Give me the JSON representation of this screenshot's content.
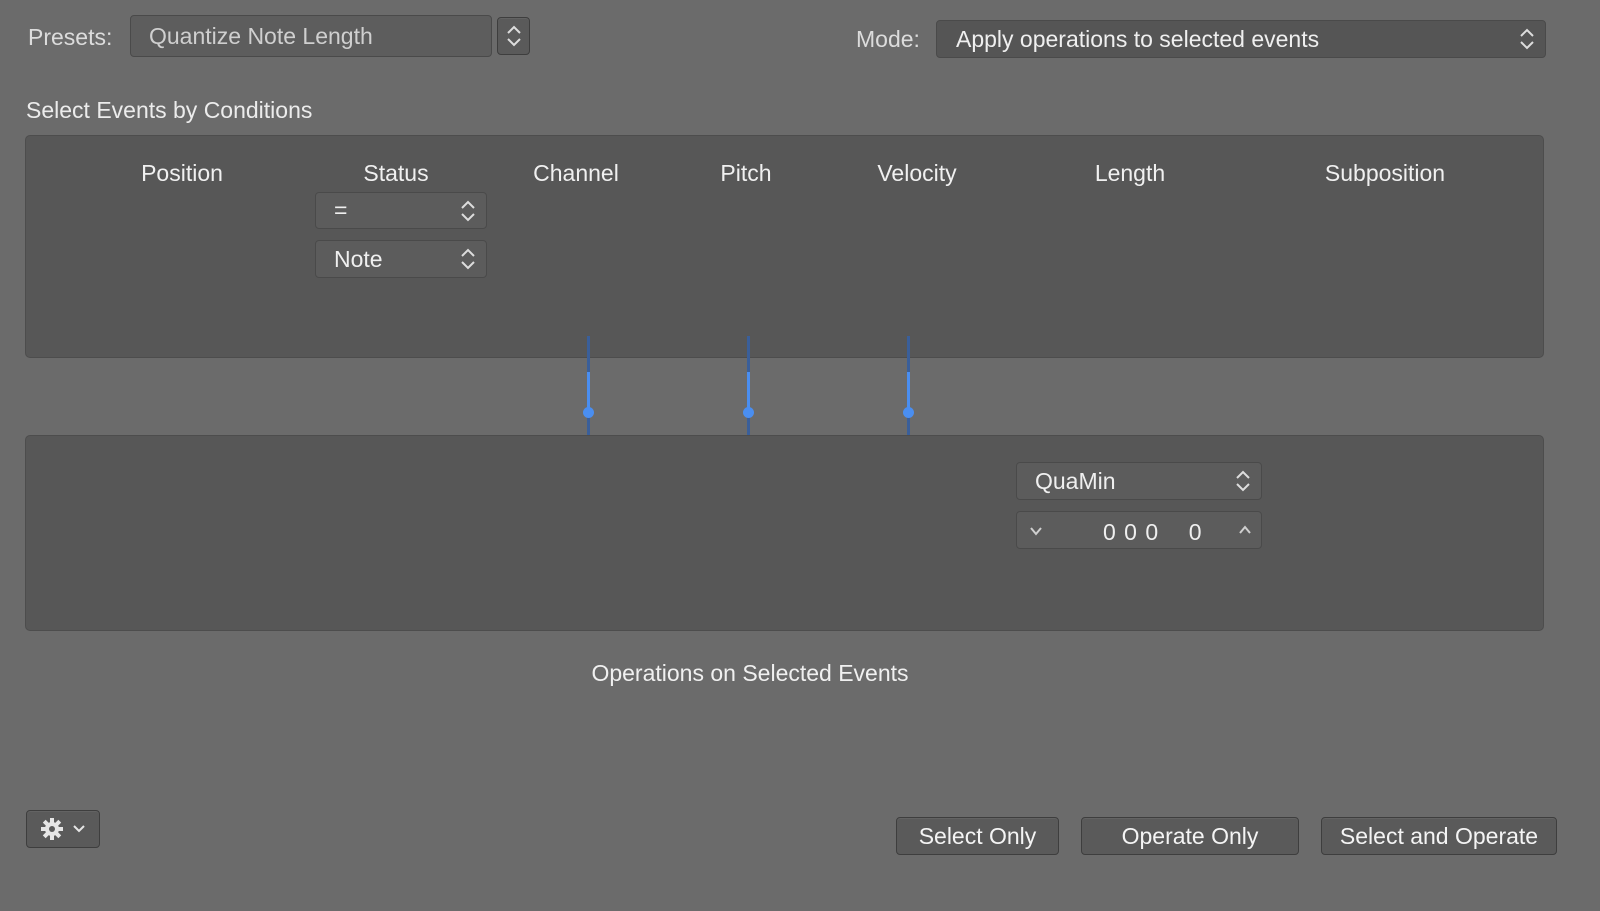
{
  "header": {
    "presets_label": "Presets:",
    "preset_value": "Quantize Note Length",
    "mode_label": "Mode:",
    "mode_value": "Apply operations to selected events"
  },
  "conditions": {
    "section_title": "Select Events by Conditions",
    "columns": [
      "Position",
      "Status",
      "Channel",
      "Pitch",
      "Velocity",
      "Length",
      "Subposition"
    ],
    "status_operator": "=",
    "status_value": "Note"
  },
  "operations": {
    "length_operation": "QuaMin",
    "length_value": "0 0 0    0",
    "section_title": "Operations on Selected Events"
  },
  "footer": {
    "select_only": "Select Only",
    "operate_only": "Operate Only",
    "select_and_operate": "Select and Operate"
  },
  "colors": {
    "accent": "#4a8ef0",
    "background": "#6b6b6b",
    "panel": "#575757"
  },
  "icons": [
    "up-down-stepper-icon",
    "gear-icon",
    "chevron-down-icon",
    "chevron-up-icon"
  ]
}
